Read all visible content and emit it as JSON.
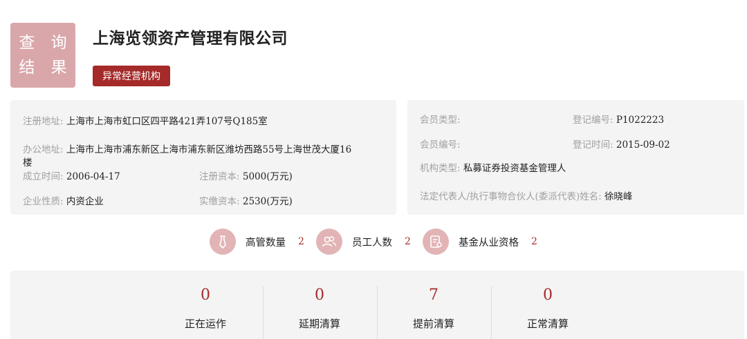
{
  "badge": {
    "line1": "查 询",
    "line2": "结 果"
  },
  "company": {
    "name": "上海览领资产管理有限公司",
    "status_tag": "异常经营机构"
  },
  "left_info": {
    "reg_address_label": "注册地址:",
    "reg_address": "上海市上海市虹口区四平路421弄107号Q185室",
    "office_address_label": "办公地址:",
    "office_address_line1": "上海市上海市浦东新区上海市浦东新区潍坊西路55号上海世茂大厦16",
    "office_address_line2": "楼",
    "founded_label": "成立时间:",
    "founded": "2006-04-17",
    "reg_capital_label": "注册资本:",
    "reg_capital": "5000(万元)",
    "nature_label": "企业性质:",
    "nature": "内资企业",
    "paid_capital_label": "实缴资本:",
    "paid_capital": "2530(万元)"
  },
  "right_info": {
    "member_type_label": "会员类型:",
    "member_type": "",
    "reg_no_label": "登记编号:",
    "reg_no": "P1022223",
    "member_no_label": "会员编号:",
    "member_no": "",
    "reg_date_label": "登记时间:",
    "reg_date": "2015-09-02",
    "org_type_label": "机构类型:",
    "org_type": "私募证券投资基金管理人",
    "legal_rep_label": "法定代表人/执行事物合伙人(委派代表)姓名:",
    "legal_rep": "徐晓峰"
  },
  "stats": [
    {
      "label": "高管数量",
      "value": "2",
      "icon": "tie-icon"
    },
    {
      "label": "员工人数",
      "value": "2",
      "icon": "people-icon"
    },
    {
      "label": "基金从业资格",
      "value": "2",
      "icon": "certificate-icon"
    }
  ],
  "fund_counts": [
    {
      "count": "0",
      "label": "正在运作"
    },
    {
      "count": "0",
      "label": "延期清算"
    },
    {
      "count": "7",
      "label": "提前清算"
    },
    {
      "count": "0",
      "label": "正常清算"
    }
  ],
  "colors": {
    "accent": "#a52a2a",
    "badge_bg": "#d9a7aa",
    "panel_bg": "#f4f4f4",
    "icon_bg": "#e2b4b6"
  }
}
